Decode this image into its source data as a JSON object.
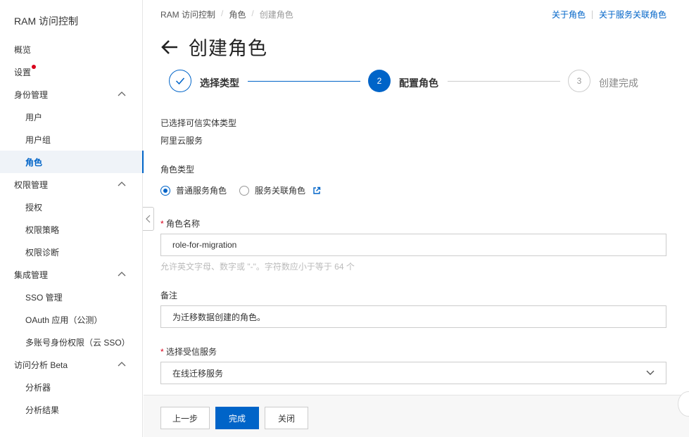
{
  "sidebar": {
    "brand": "RAM 访问控制",
    "items": [
      {
        "label": "概览"
      },
      {
        "label": "设置"
      },
      {
        "label": "身份管理"
      },
      {
        "label": "用户"
      },
      {
        "label": "用户组"
      },
      {
        "label": "角色"
      },
      {
        "label": "权限管理"
      },
      {
        "label": "授权"
      },
      {
        "label": "权限策略"
      },
      {
        "label": "权限诊断"
      },
      {
        "label": "集成管理"
      },
      {
        "label": "SSO 管理"
      },
      {
        "label": "OAuth 应用（公测）"
      },
      {
        "label": "多账号身份权限（云 SSO）"
      },
      {
        "label": "访问分析 Beta"
      },
      {
        "label": "分析器"
      },
      {
        "label": "分析结果"
      }
    ]
  },
  "breadcrumb": [
    "RAM 访问控制",
    "角色",
    "创建角色"
  ],
  "top_links": [
    "关于角色",
    "关于服务关联角色"
  ],
  "page_title": "创建角色",
  "steps": [
    {
      "label": "选择类型",
      "status": "done"
    },
    {
      "number": "2",
      "label": "配置角色",
      "status": "current"
    },
    {
      "number": "3",
      "label": "创建完成",
      "status": "wait"
    }
  ],
  "form": {
    "trusted_entity_label": "已选择可信实体类型",
    "trusted_entity_value": "阿里云服务",
    "role_type_label": "角色类型",
    "role_type_options": [
      "普通服务角色",
      "服务关联角色"
    ],
    "role_name_label": "角色名称",
    "role_name_value": "role-for-migration",
    "role_name_hint": "允许英文字母、数字或 \"-\"。字符数应小于等于 64 个",
    "remark_label": "备注",
    "remark_value": "为迁移数据创建的角色。",
    "trusted_service_label": "选择受信服务",
    "trusted_service_value": "在线迁移服务"
  },
  "footer": {
    "prev": "上一步",
    "finish": "完成",
    "close": "关闭"
  },
  "colors": {
    "primary": "#0064c8",
    "required": "#d9001b",
    "active_bg": "#eff3f8"
  }
}
